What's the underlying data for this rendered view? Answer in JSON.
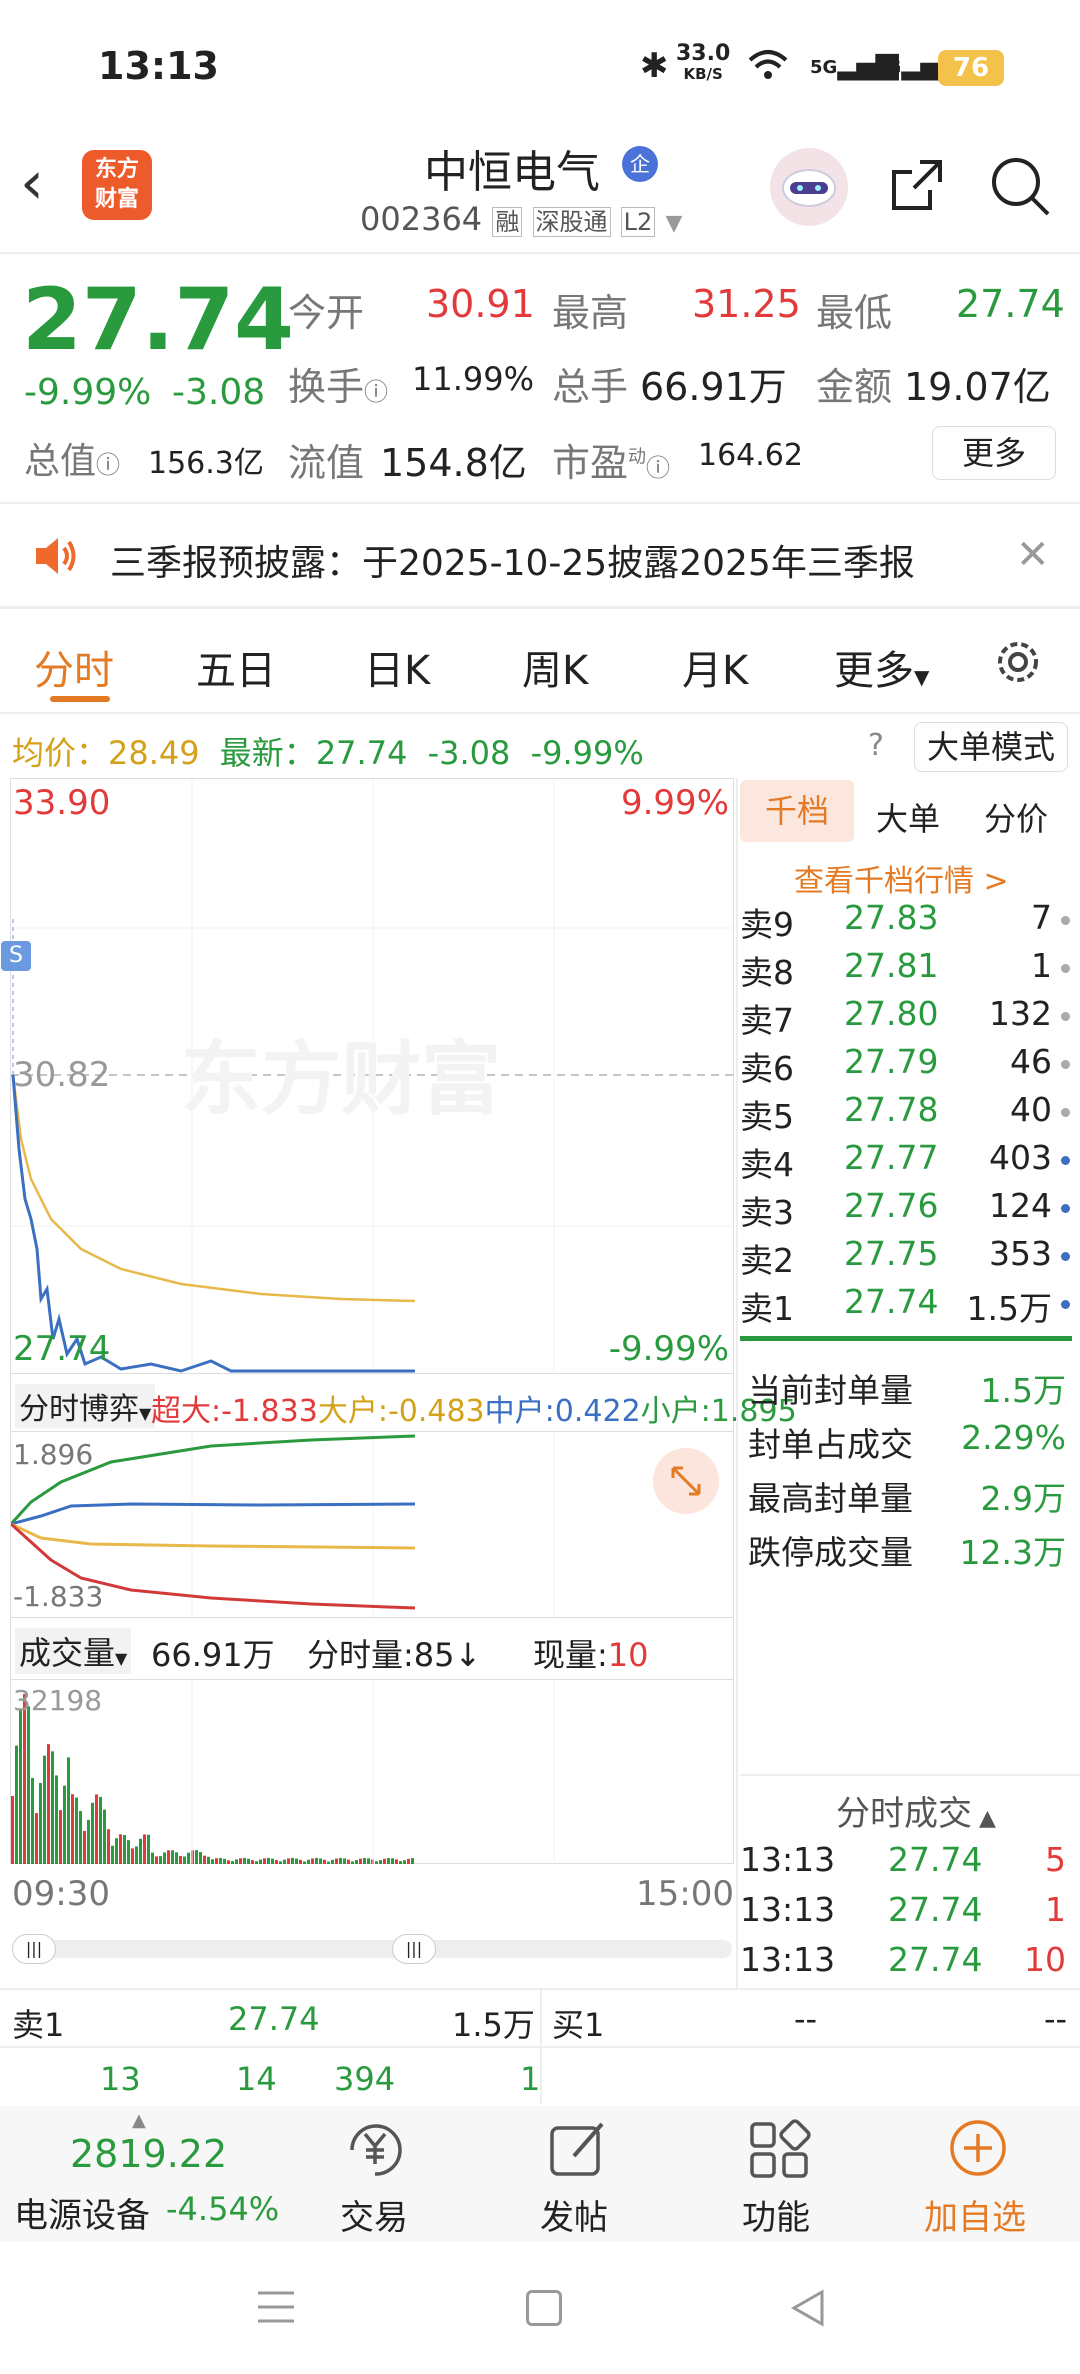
{
  "status": {
    "time": "13:13",
    "net_speed": "33.0",
    "net_unit": "KB/S",
    "sig1": "5G",
    "sig2": "5G",
    "battery": "76"
  },
  "header": {
    "title": "中恒电气",
    "qi_badge": "企",
    "code": "002364",
    "tags": [
      "融",
      "深股通",
      "L2"
    ],
    "logo_l1": "东方",
    "logo_l2": "财富"
  },
  "quote": {
    "price": "27.74",
    "pct": "-9.99%",
    "chg": "-3.08",
    "open_label": "今开",
    "open": "30.91",
    "high_label": "最高",
    "high": "31.25",
    "low_label": "最低",
    "low": "27.74",
    "turnover_label": "换手",
    "turnover": "11.99%",
    "vol_label": "总手",
    "vol": "66.91万",
    "amt_label": "金额",
    "amt": "19.07亿",
    "mcap_label": "总值",
    "mcap": "156.3亿",
    "float_label": "流值",
    "float": "154.8亿",
    "pe_label": "市盈",
    "pe_sup": "动",
    "pe": "164.62",
    "more": "更多"
  },
  "notice": {
    "text": "三季报预披露：于2025-10-25披露2025年三季报"
  },
  "tabs": [
    "分时",
    "五日",
    "日K",
    "周K",
    "月K",
    "更多"
  ],
  "avg_bar": {
    "avg_label": "均价：",
    "avg": "28.49",
    "last_label": "最新：",
    "last": "27.74",
    "chg": "-3.08",
    "pct": "-9.99%",
    "mode": "大单模式"
  },
  "chart": {
    "top_price": "33.90",
    "top_pct": "9.99%",
    "mid_price": "30.82",
    "bot_price": "27.74",
    "bot_pct": "-9.99%",
    "marker": "S",
    "watermark": "东方财富",
    "time_start": "09:30",
    "time_end": "15:00"
  },
  "flow": {
    "label": "分时博弈",
    "super_label": "超大:",
    "super": "-1.833",
    "big_label": "大户:",
    "big": "-0.483",
    "mid_label": "中户:",
    "mid": "0.422",
    "small_label": "小户:",
    "small": "1.895",
    "max": "1.896",
    "min": "-1.833"
  },
  "volume": {
    "label": "成交量",
    "total": "66.91万",
    "tick_label": "分时量:",
    "tick": "85↓",
    "now_label": "现量:",
    "now": "10",
    "max": "32198"
  },
  "orderbook": {
    "tabs": [
      "千档",
      "大单",
      "分价"
    ],
    "link": "查看千档行情 >",
    "asks": [
      {
        "l": "卖9",
        "p": "27.83",
        "v": "7"
      },
      {
        "l": "卖8",
        "p": "27.81",
        "v": "1"
      },
      {
        "l": "卖7",
        "p": "27.80",
        "v": "132"
      },
      {
        "l": "卖6",
        "p": "27.79",
        "v": "46"
      },
      {
        "l": "卖5",
        "p": "27.78",
        "v": "40"
      },
      {
        "l": "卖4",
        "p": "27.77",
        "v": "403"
      },
      {
        "l": "卖3",
        "p": "27.76",
        "v": "124"
      },
      {
        "l": "卖2",
        "p": "27.75",
        "v": "353"
      },
      {
        "l": "卖1",
        "p": "27.74",
        "v": "1.5万"
      }
    ],
    "stats": [
      {
        "l": "当前封单量",
        "v": "1.5万"
      },
      {
        "l": "封单占成交",
        "v": "2.29%"
      },
      {
        "l": "最高封单量",
        "v": "2.9万"
      },
      {
        "l": "跌停成交量",
        "v": "12.3万"
      }
    ],
    "trades_title": "分时成交",
    "trades": [
      {
        "t": "13:13",
        "p": "27.74",
        "v": "5"
      },
      {
        "t": "13:13",
        "p": "27.74",
        "v": "1"
      },
      {
        "t": "13:13",
        "p": "27.74",
        "v": "10"
      }
    ]
  },
  "bottom_quote": {
    "ask_label": "卖1",
    "ask_p": "27.74",
    "ask_v": "1.5万",
    "bid_label": "买1",
    "bid_p": "--",
    "bid_v": "--",
    "n1": "13",
    "n2": "14",
    "n3": "394",
    "n4": "1"
  },
  "nav": {
    "index_val": "2819.22",
    "index_name": "电源设备",
    "index_pct": "-4.54%",
    "trade": "交易",
    "post": "发帖",
    "func": "功能",
    "add": "加自选"
  },
  "colors": {
    "up": "#e23a3a",
    "down": "#2a9a3e",
    "accent": "#e47b24",
    "avg": "#e8b84a",
    "blue": "#3a6fc2"
  }
}
